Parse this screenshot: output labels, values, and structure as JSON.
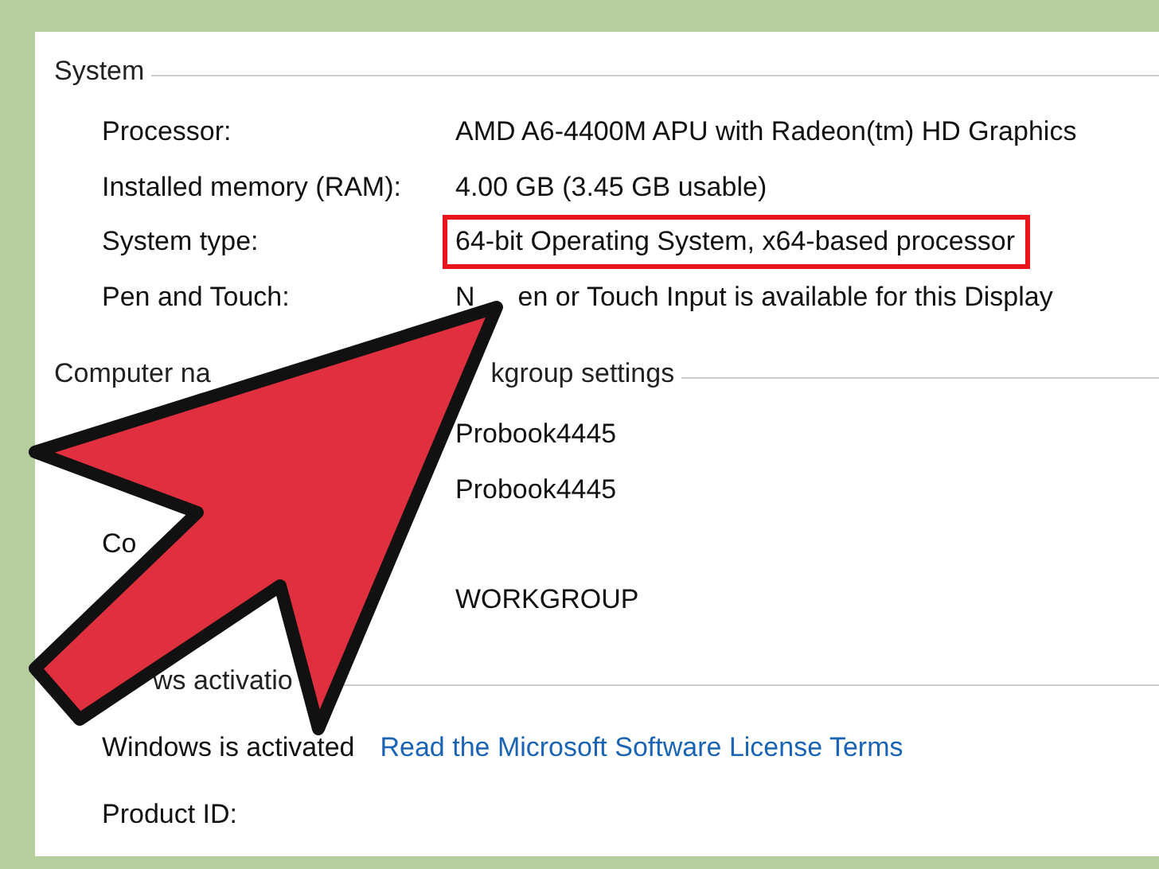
{
  "sections": [
    {
      "title_parts": [
        "System"
      ],
      "rows": [
        {
          "kind": "pair",
          "label": "Processor:",
          "value_parts": [
            "AMD A6-4400M APU with Radeon(tm) HD Graphics"
          ],
          "highlighted": false
        },
        {
          "kind": "pair",
          "label": "Installed memory (RAM):",
          "value_parts": [
            "4.00 GB (3.45 GB usable)"
          ],
          "highlighted": false
        },
        {
          "kind": "pair",
          "label": "System type:",
          "value_parts": [
            "64-bit Operating System, x64-based processor"
          ],
          "highlighted": true
        },
        {
          "kind": "pair",
          "label": "Pen and Touch:",
          "value_parts": [
            "N",
            "en or Touch Input is available for this Display"
          ],
          "highlighted": false
        }
      ]
    },
    {
      "title_parts": [
        "Computer na",
        "kgroup settings"
      ],
      "rows": [
        {
          "kind": "pair",
          "value_parts": [
            "Probook4445"
          ],
          "highlighted": false
        },
        {
          "kind": "pair",
          "value_parts": [
            "Probook4445"
          ],
          "highlighted": false
        },
        {
          "kind": "pair",
          "label": "Co",
          "highlighted": false
        },
        {
          "kind": "pair",
          "value_parts": [
            "WORKGROUP"
          ],
          "highlighted": false
        }
      ]
    },
    {
      "title_parts": [
        "ws activatio"
      ],
      "rows": [
        {
          "kind": "link",
          "label": "Windows is activated",
          "link": "Read the Microsoft Software License Terms"
        },
        {
          "kind": "pair",
          "label": "Product ID:",
          "highlighted": false
        }
      ]
    }
  ]
}
